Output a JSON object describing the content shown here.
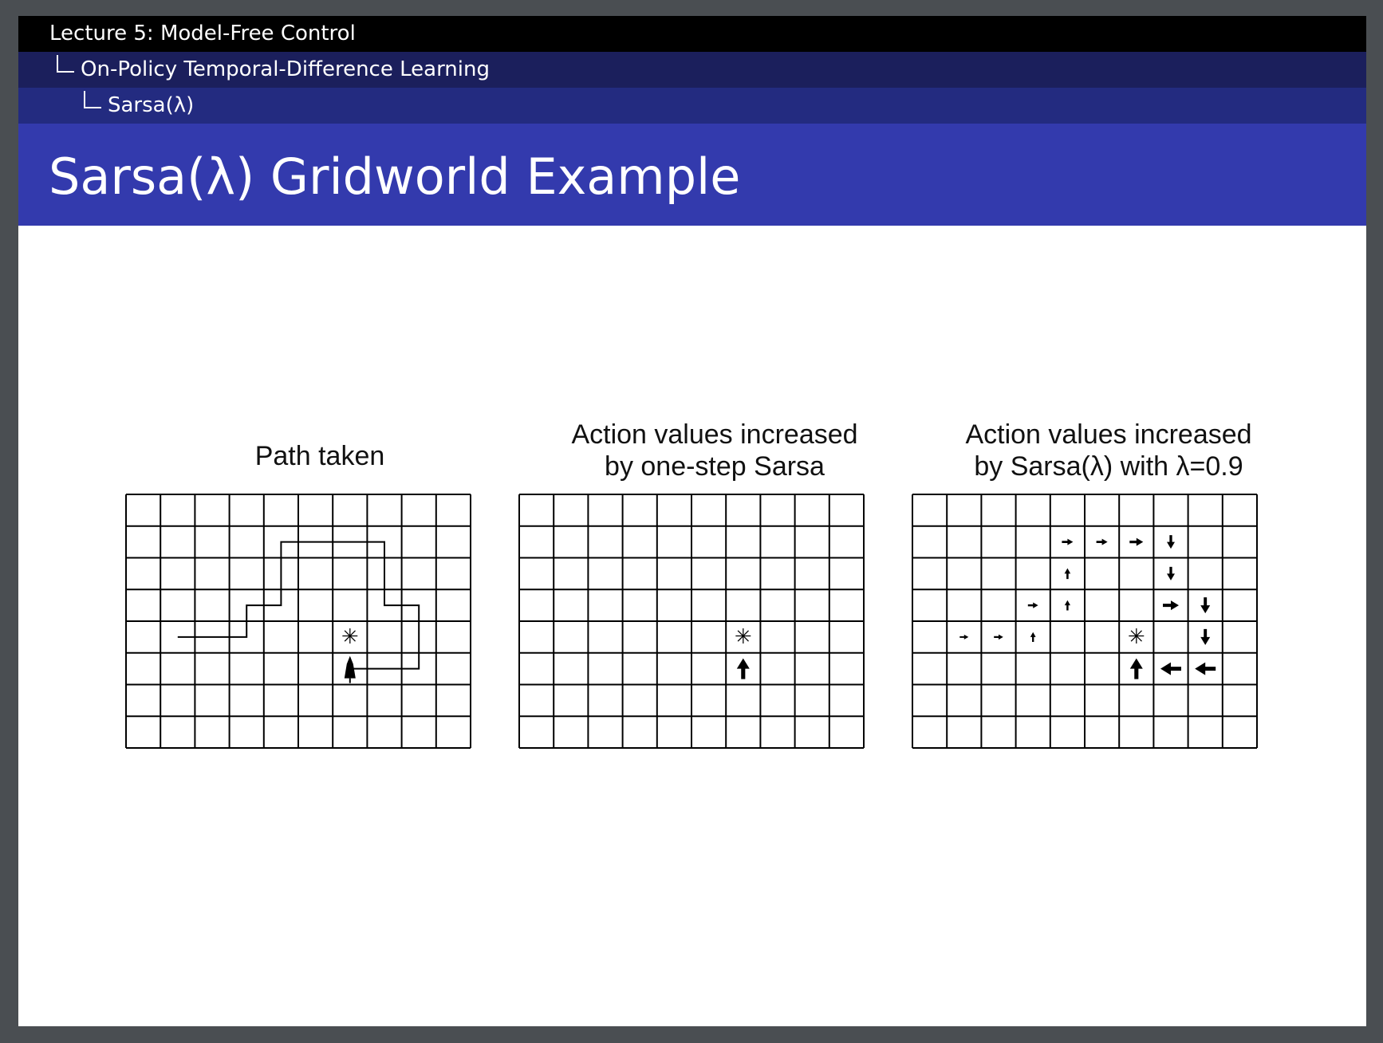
{
  "header": {
    "lecture": "Lecture 5: Model-Free Control",
    "section": "On-Policy Temporal-Difference Learning",
    "subsection": "Sarsa(λ)"
  },
  "slide": {
    "title": "Sarsa(λ) Gridworld Example"
  },
  "figure": {
    "grid": {
      "columns": 10,
      "rows": 8
    },
    "goal_symbol": "✳",
    "panels": [
      {
        "title_line1": "Path taken",
        "title_line2": "",
        "path": [
          [
            1.5,
            4.5
          ],
          [
            3.5,
            4.5
          ],
          [
            3.5,
            3.5
          ],
          [
            4.5,
            3.5
          ],
          [
            4.5,
            1.5
          ],
          [
            7.5,
            1.5
          ],
          [
            7.5,
            3.5
          ],
          [
            8.5,
            3.5
          ],
          [
            8.5,
            5.5
          ],
          [
            6.5,
            5.5
          ]
        ],
        "agent_cells": [
          [
            6,
            5
          ]
        ],
        "goal_cell": [
          6,
          4
        ],
        "arrows": []
      },
      {
        "title_line1": "Action values increased",
        "title_line2": "by one-step Sarsa",
        "path": [],
        "agent_cells": [],
        "goal_cell": [
          6,
          4
        ],
        "arrows": [
          {
            "col": 6,
            "row": 5,
            "dir": "up",
            "size": 3
          }
        ]
      },
      {
        "title_line1": "Action values increased",
        "title_line2": "by Sarsa(λ) with λ=0.9",
        "path": [],
        "agent_cells": [],
        "goal_cell": [
          6,
          4
        ],
        "arrows": [
          {
            "col": 6,
            "row": 5,
            "dir": "up",
            "size": 3
          },
          {
            "col": 7,
            "row": 5,
            "dir": "left",
            "size": 3
          },
          {
            "col": 8,
            "row": 5,
            "dir": "left",
            "size": 3
          },
          {
            "col": 8,
            "row": 4,
            "dir": "down",
            "size": 2
          },
          {
            "col": 8,
            "row": 3,
            "dir": "down",
            "size": 2
          },
          {
            "col": 7,
            "row": 3,
            "dir": "right",
            "size": 2
          },
          {
            "col": 7,
            "row": 2,
            "dir": "down",
            "size": 1.5
          },
          {
            "col": 7,
            "row": 1,
            "dir": "down",
            "size": 1.5
          },
          {
            "col": 6,
            "row": 1,
            "dir": "right",
            "size": 1.5
          },
          {
            "col": 5,
            "row": 1,
            "dir": "right",
            "size": 1
          },
          {
            "col": 4,
            "row": 1,
            "dir": "right",
            "size": 1
          },
          {
            "col": 4,
            "row": 2,
            "dir": "up",
            "size": 0.9
          },
          {
            "col": 4,
            "row": 3,
            "dir": "up",
            "size": 0.8
          },
          {
            "col": 3,
            "row": 3,
            "dir": "right",
            "size": 0.8
          },
          {
            "col": 3,
            "row": 4,
            "dir": "up",
            "size": 0.7
          },
          {
            "col": 2,
            "row": 4,
            "dir": "right",
            "size": 0.6
          },
          {
            "col": 1,
            "row": 4,
            "dir": "right",
            "size": 0.5
          }
        ]
      }
    ]
  }
}
